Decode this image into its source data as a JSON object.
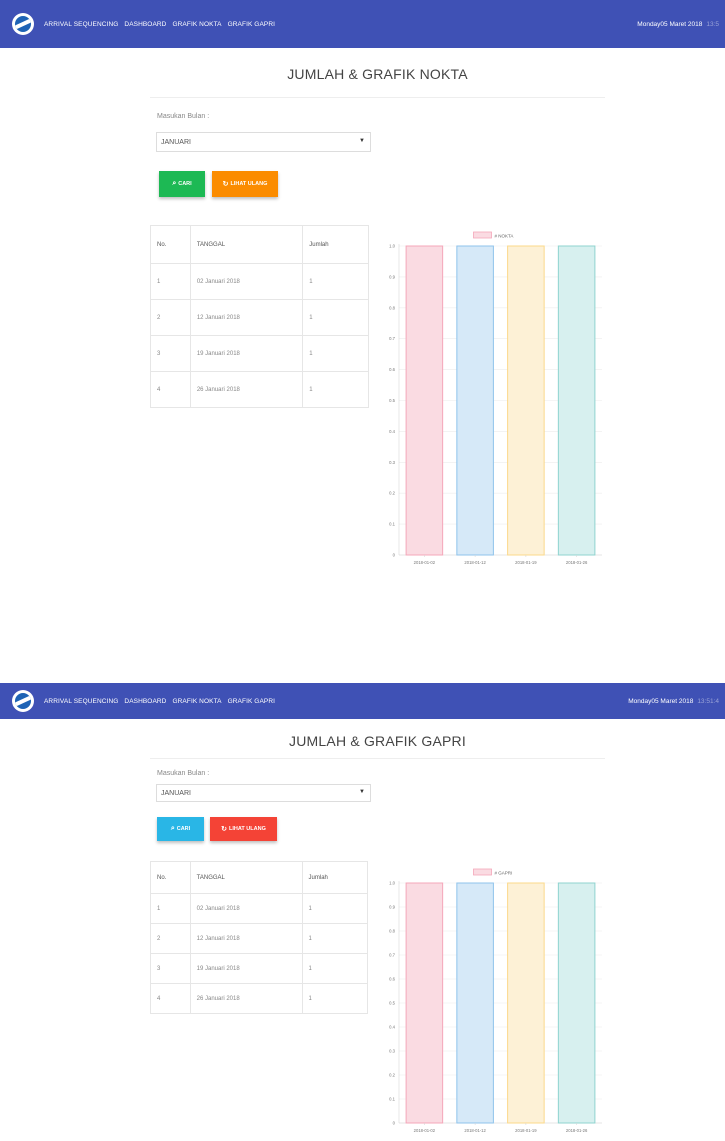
{
  "nav": {
    "links": [
      "ARRIVAL SEQUENCING",
      "DASHBOARD",
      "GRAFIK NOKTA",
      "GRAFIK GAPRI"
    ],
    "date": "Monday05 Maret 2018",
    "time_1": "13:5",
    "time_2": "13:51:4"
  },
  "colors": {
    "navbar": "#3f51b5",
    "btn_cari_1": "#1db954",
    "btn_lihat_1": "#fb8c00",
    "btn_cari_2": "#29b6e6",
    "btn_lihat_2": "#f44336"
  },
  "icons": {
    "logo": "globe-logo-icon",
    "cari": "search-icon",
    "lihat": "refresh-icon"
  },
  "panels": [
    {
      "title": "JUMLAH & GRAFIK NOKTA",
      "month_label": "Masukan Bulan :",
      "month_value": "JANUARI",
      "btn_cari": "CARI",
      "btn_lihat": "LIHAT ULANG",
      "table": {
        "headers": [
          "No.",
          "TANGGAL",
          "Jumlah"
        ],
        "rows": [
          [
            "1",
            "02 Januari 2018",
            "1"
          ],
          [
            "2",
            "12 Januari 2018",
            "1"
          ],
          [
            "3",
            "19 Januari 2018",
            "1"
          ],
          [
            "4",
            "26 Januari 2018",
            "1"
          ]
        ]
      }
    },
    {
      "title": "JUMLAH & GRAFIK GAPRI",
      "month_label": "Masukan Bulan :",
      "month_value": "JANUARI",
      "btn_cari": "CARI",
      "btn_lihat": "LIHAT ULANG",
      "table": {
        "headers": [
          "No.",
          "TANGGAL",
          "Jumlah"
        ],
        "rows": [
          [
            "1",
            "02 Januari 2018",
            "1"
          ],
          [
            "2",
            "12 Januari 2018",
            "1"
          ],
          [
            "3",
            "19 Januari 2018",
            "1"
          ],
          [
            "4",
            "26 Januari 2018",
            "1"
          ]
        ]
      }
    }
  ],
  "chart_data": [
    {
      "type": "bar",
      "categories": [
        "2018-01-02",
        "2018-01-12",
        "2018-01-19",
        "2018-01-26"
      ],
      "series": [
        {
          "name": "# NOKTA",
          "values": [
            1,
            1,
            1,
            1
          ]
        }
      ],
      "ylim": [
        0,
        1
      ],
      "yticks": [
        "0",
        "0.1",
        "0.2",
        "0.3",
        "0.4",
        "0.5",
        "0.6",
        "0.7",
        "0.8",
        "0.9",
        "1.0"
      ],
      "bar_fill": [
        "#fadbe2",
        "#d6e9f8",
        "#fdf1d6",
        "#d7f0ef"
      ],
      "bar_stroke": [
        "#f4a7b9",
        "#8fc3eb",
        "#fbd98a",
        "#8fd3cf"
      ],
      "legend": "top",
      "grid": true
    },
    {
      "type": "bar",
      "categories": [
        "2018-01-02",
        "2018-01-12",
        "2018-01-19",
        "2018-01-26"
      ],
      "series": [
        {
          "name": "# GAPRI",
          "values": [
            1,
            1,
            1,
            1
          ]
        }
      ],
      "ylim": [
        0,
        1
      ],
      "yticks": [
        "0",
        "0.1",
        "0.2",
        "0.3",
        "0.4",
        "0.5",
        "0.6",
        "0.7",
        "0.8",
        "0.9",
        "1.0"
      ],
      "bar_fill": [
        "#fadbe2",
        "#d6e9f8",
        "#fdf1d6",
        "#d7f0ef"
      ],
      "bar_stroke": [
        "#f4a7b9",
        "#8fc3eb",
        "#fbd98a",
        "#8fd3cf"
      ],
      "legend": "top",
      "grid": true
    }
  ]
}
